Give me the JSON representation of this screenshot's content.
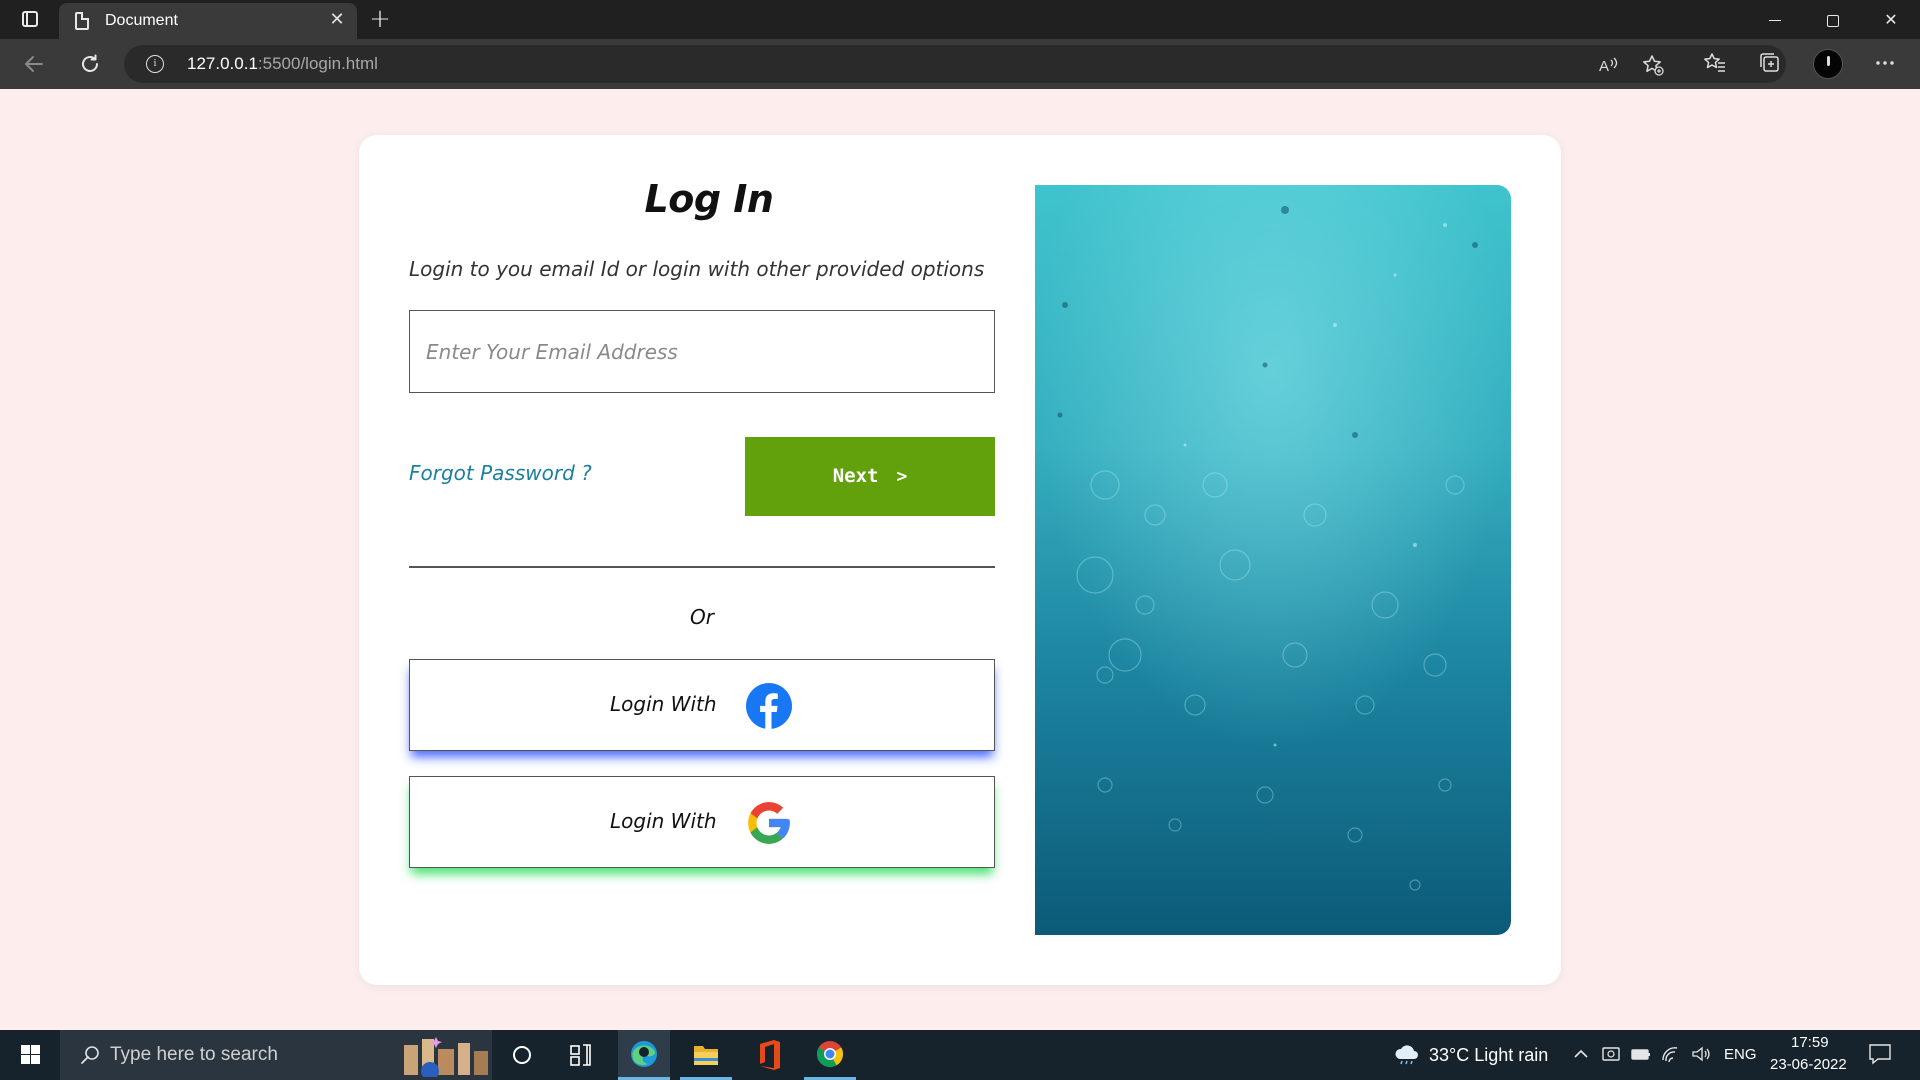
{
  "browser": {
    "tab_title": "Document",
    "tab_close": "✕",
    "new_tab": "+",
    "url_host": "127.0.0.1",
    "url_path": ":5500/login.html",
    "icons": [
      "tab-actions-icon",
      "document-icon",
      "back-icon",
      "reload-icon",
      "site-info-icon",
      "read-aloud-icon",
      "add-favorite-icon",
      "favorites-icon",
      "collections-icon",
      "profile-icon",
      "more-icon"
    ],
    "window_controls": {
      "minimize": "",
      "maximize": "",
      "close": "✕"
    }
  },
  "login": {
    "title": "Log In",
    "subtitle": "Login to you email Id or login with other provided options",
    "email_placeholder": "Enter Your Email Address",
    "forgot_password": "Forgot Password ?",
    "next_label": "Next",
    "next_chevron": ">",
    "or_text": "Or",
    "facebook_label": "Login With",
    "google_label": "Login With",
    "colors": {
      "page_background": "#fdeded",
      "next_button": "#62a10b",
      "forgot_link": "#1b7fa0",
      "facebook_glow": "#2850ff",
      "google_glow": "#28dc5a"
    }
  },
  "taskbar": {
    "search_placeholder": "Type here to search",
    "weather": "33°C  Light rain",
    "language": "ENG",
    "time": "17:59",
    "date": "23-06-2022",
    "apps": [
      "cortana-icon",
      "task-view-icon",
      "edge-icon",
      "file-explorer-icon",
      "office-icon",
      "chrome-icon"
    ]
  }
}
